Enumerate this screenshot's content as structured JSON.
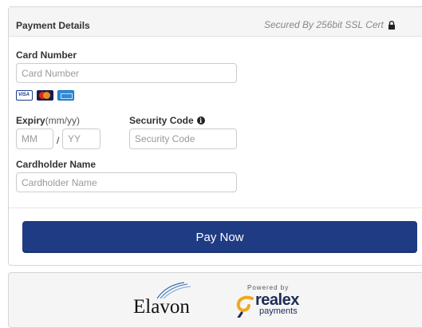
{
  "payment": {
    "title": "Payment Details",
    "secured_text": "Secured By 256bit SSL Cert",
    "card_number": {
      "label": "Card Number",
      "placeholder": "Card Number"
    },
    "cards": [
      "visa-icon",
      "mastercard-icon",
      "amex-icon"
    ],
    "expiry": {
      "label": "Expiry",
      "hint": "(mm/yy)",
      "mm_placeholder": "MM",
      "separator": "/",
      "yy_placeholder": "YY"
    },
    "security_code": {
      "label": "Security Code",
      "placeholder": "Security Code"
    },
    "cardholder": {
      "label": "Cardholder Name",
      "placeholder": "Cardholder Name"
    },
    "pay_button": "Pay Now"
  },
  "footer": {
    "elavon": "Elavon",
    "powered_by": "Powered by",
    "realex": "realex",
    "realex_sub": "payments"
  },
  "colors": {
    "button": "#1f3b84",
    "panel_header": "#f5f5f5",
    "border": "#d6d6d6"
  }
}
